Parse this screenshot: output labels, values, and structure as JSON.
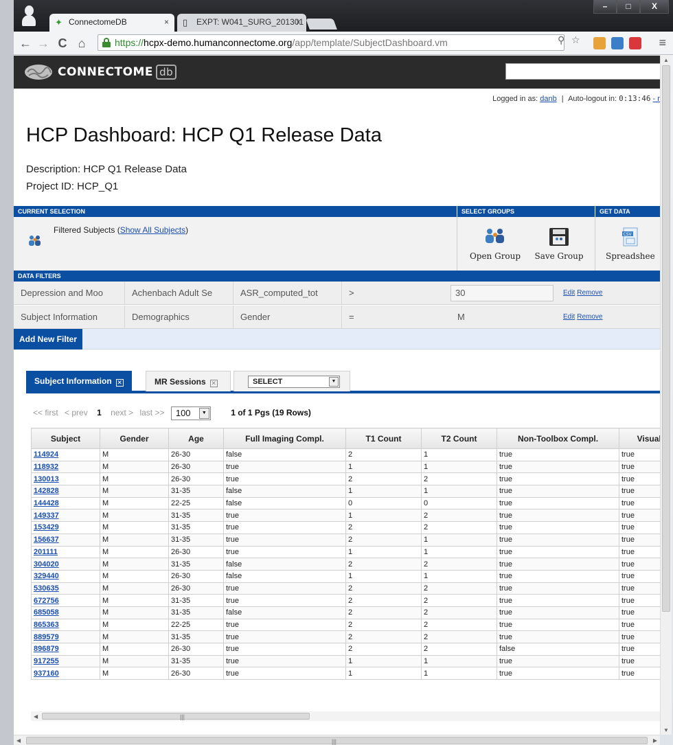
{
  "browser": {
    "tabs": [
      {
        "label": "ConnectomeDB",
        "close": "×"
      },
      {
        "label": "EXPT: W041_SURG_201301",
        "close": "×"
      }
    ],
    "window_controls": [
      "–",
      "□",
      "X"
    ],
    "nav": {
      "back": "←",
      "forward": "→",
      "reload": "C",
      "home": "⌂"
    },
    "url": {
      "scheme": "https://",
      "host": "hcpx-demo.humanconnectome.org",
      "path": "/app/template/SubjectDashboard.vm"
    },
    "menu": "≡"
  },
  "site": {
    "brand": "CONNECTOME",
    "brand_suffix": "db",
    "search_placeholder": ""
  },
  "session": {
    "logged_in_label": "Logged in as:",
    "user": "danb",
    "separator": "|",
    "auto_logout_label": "Auto-logout in:",
    "timer": "0:13:46",
    "trailing": "- re"
  },
  "page": {
    "title": "HCP Dashboard: HCP Q1 Release Data",
    "description": "Description: HCP Q1 Release Data",
    "project_id": "Project ID: HCP_Q1"
  },
  "panels": {
    "current_selection": {
      "heading": "CURRENT SELECTION",
      "text": "Filtered Subjects (",
      "link": "Show All Subjects",
      "text_end": ")"
    },
    "select_groups": {
      "heading": "SELECT GROUPS",
      "open_group": "Open Group",
      "save_group": "Save Group"
    },
    "get_data": {
      "heading": "GET DATA",
      "spreadsheet": "Spreadshee",
      "csv_label": "CSV"
    }
  },
  "filters": {
    "heading": "DATA FILTERS",
    "rows": [
      {
        "category": "Depression and Moo",
        "instrument": "Achenbach Adult Se",
        "field": "ASR_computed_tot",
        "operator": ">",
        "value": "30",
        "edit": "Edit",
        "remove": "Remove"
      },
      {
        "category": "Subject Information",
        "instrument": "Demographics",
        "field": "Gender",
        "operator": "=",
        "value": "M",
        "edit": "Edit",
        "remove": "Remove"
      }
    ],
    "add_button": "Add New Filter"
  },
  "data_tabs": [
    {
      "label": "Subject Information",
      "close": "✕"
    },
    {
      "label": "MR Sessions",
      "close": "✕"
    }
  ],
  "tab_select": {
    "value": "SELECT",
    "arrow": "▼"
  },
  "pager": {
    "first": "<< first",
    "prev": "< prev",
    "current": "1",
    "next": "next >",
    "last": "last >>",
    "page_size": "100",
    "arrow": "▼",
    "summary": "1 of 1 Pgs (19 Rows)"
  },
  "table": {
    "columns": [
      "Subject",
      "Gender",
      "Age",
      "Full Imaging Compl.",
      "T1 Count",
      "T2 Count",
      "Non-Toolbox Compl.",
      "Visual I"
    ],
    "rows": [
      [
        "114924",
        "M",
        "26-30",
        "false",
        "2",
        "1",
        "true",
        "true"
      ],
      [
        "118932",
        "M",
        "26-30",
        "true",
        "1",
        "1",
        "true",
        "true"
      ],
      [
        "130013",
        "M",
        "26-30",
        "true",
        "2",
        "2",
        "true",
        "true"
      ],
      [
        "142828",
        "M",
        "31-35",
        "false",
        "1",
        "1",
        "true",
        "true"
      ],
      [
        "144428",
        "M",
        "22-25",
        "false",
        "0",
        "0",
        "true",
        "true"
      ],
      [
        "149337",
        "M",
        "31-35",
        "true",
        "1",
        "2",
        "true",
        "true"
      ],
      [
        "153429",
        "M",
        "31-35",
        "true",
        "2",
        "2",
        "true",
        "true"
      ],
      [
        "156637",
        "M",
        "31-35",
        "true",
        "2",
        "1",
        "true",
        "true"
      ],
      [
        "201111",
        "M",
        "26-30",
        "true",
        "1",
        "1",
        "true",
        "true"
      ],
      [
        "304020",
        "M",
        "31-35",
        "false",
        "2",
        "2",
        "true",
        "true"
      ],
      [
        "329440",
        "M",
        "26-30",
        "false",
        "1",
        "1",
        "true",
        "true"
      ],
      [
        "530635",
        "M",
        "26-30",
        "true",
        "2",
        "2",
        "true",
        "true"
      ],
      [
        "672756",
        "M",
        "31-35",
        "true",
        "2",
        "2",
        "true",
        "true"
      ],
      [
        "685058",
        "M",
        "31-35",
        "false",
        "2",
        "2",
        "true",
        "true"
      ],
      [
        "865363",
        "M",
        "22-25",
        "true",
        "2",
        "2",
        "true",
        "true"
      ],
      [
        "889579",
        "M",
        "31-35",
        "true",
        "2",
        "2",
        "true",
        "true"
      ],
      [
        "896879",
        "M",
        "26-30",
        "true",
        "2",
        "2",
        "false",
        "true"
      ],
      [
        "917255",
        "M",
        "31-35",
        "true",
        "1",
        "1",
        "true",
        "true"
      ],
      [
        "937160",
        "M",
        "26-30",
        "true",
        "1",
        "1",
        "true",
        "true"
      ]
    ]
  },
  "colors": {
    "brand_blue": "#0b4fa2",
    "link": "#1a4fb0",
    "header_dark": "#2b2b2b"
  }
}
